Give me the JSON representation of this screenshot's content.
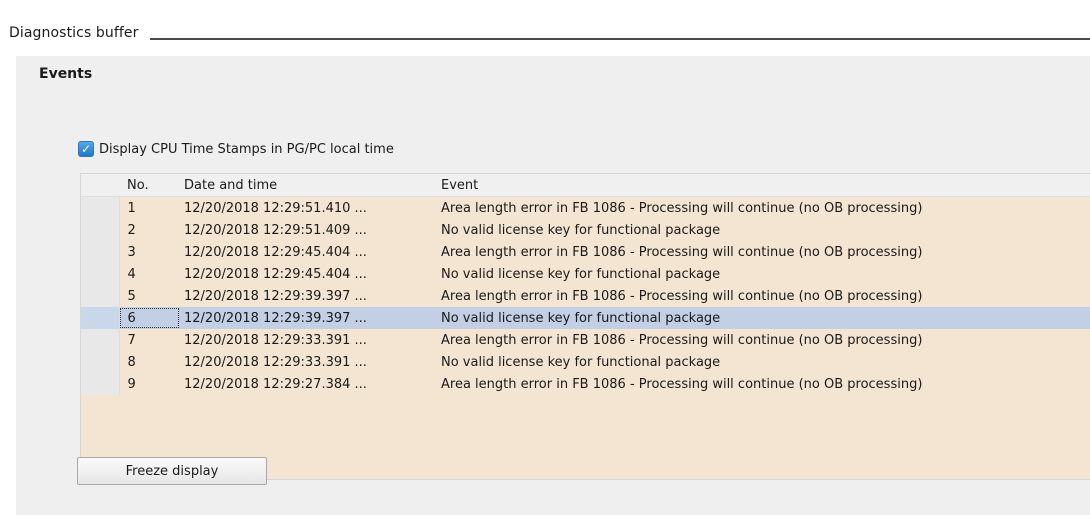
{
  "section": {
    "title": "Diagnostics buffer"
  },
  "events": {
    "title": "Events",
    "checkbox": {
      "label": "Display CPU Time Stamps in PG/PC local time",
      "checked": true
    },
    "table": {
      "columns": [
        "No.",
        "Date and time",
        "Event"
      ],
      "rows": [
        {
          "no": "1",
          "datetime": "12/20/2018 12:29:51.410 ...",
          "event": "Area length error in FB 1086  - Processing will continue (no OB processing)"
        },
        {
          "no": "2",
          "datetime": "12/20/2018 12:29:51.409 ...",
          "event": "No valid license key for functional package"
        },
        {
          "no": "3",
          "datetime": "12/20/2018 12:29:45.404 ...",
          "event": "Area length error in FB 1086  - Processing will continue (no OB processing)"
        },
        {
          "no": "4",
          "datetime": "12/20/2018 12:29:45.404 ...",
          "event": "No valid license key for functional package"
        },
        {
          "no": "5",
          "datetime": "12/20/2018 12:29:39.397 ...",
          "event": "Area length error in FB 1086  - Processing will continue (no OB processing)"
        },
        {
          "no": "6",
          "datetime": "12/20/2018 12:29:39.397 ...",
          "event": "No valid license key for functional package"
        },
        {
          "no": "7",
          "datetime": "12/20/2018 12:29:33.391 ...",
          "event": "Area length error in FB 1086  - Processing will continue (no OB processing)"
        },
        {
          "no": "8",
          "datetime": "12/20/2018 12:29:33.391 ...",
          "event": "No valid license key for functional package"
        },
        {
          "no": "9",
          "datetime": "12/20/2018 12:29:27.384 ...",
          "event": "Area length error in FB 1086  - Processing will continue (no OB processing)"
        }
      ],
      "selected_row": "6"
    },
    "freeze_button": {
      "label": "Freeze display"
    }
  },
  "colors": {
    "row_background": "#f4e5d2",
    "selected_row_background": "#c2cfe4",
    "panel_background": "#efefef",
    "checkbox_accent": "#1e78c8"
  },
  "icons": {
    "checkbox": "checkmark-icon"
  }
}
